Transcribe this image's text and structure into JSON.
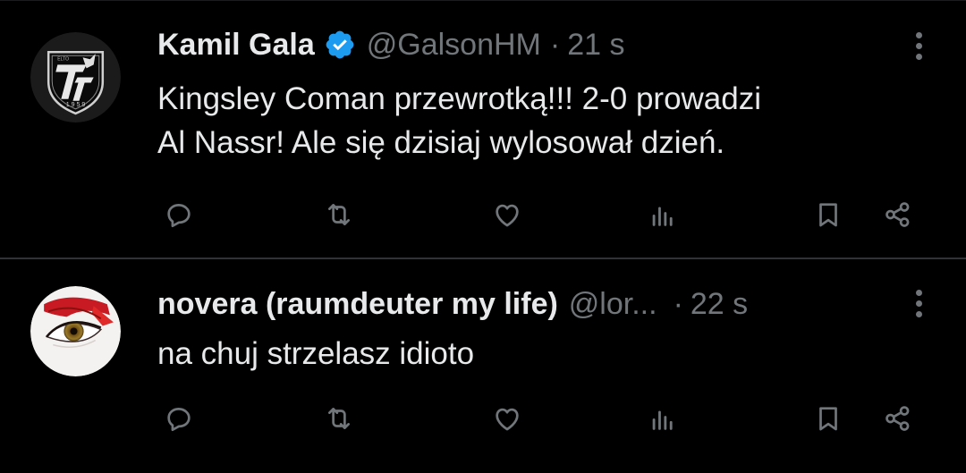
{
  "tweets": [
    {
      "name": "Kamil Gala",
      "verified": true,
      "handle": "@GalsonHM",
      "separator": "·",
      "time": "21 s",
      "text_lines": [
        "Kingsley Coman przewrotką!!! 2-0 prowadzi",
        "Al Nassr! Ale się dzisiaj wylosował dzień."
      ],
      "avatar_icon": "club-crest-logo"
    },
    {
      "name": "novera (raumdeuter my life)",
      "verified": false,
      "handle": "@lor...",
      "separator": "·",
      "time": "22 s",
      "text_lines": [
        "na chuj strzelasz idioto"
      ],
      "avatar_icon": "eye-closeup-photo"
    }
  ],
  "actions": [
    "reply-icon",
    "retweet-icon",
    "like-icon",
    "views-icon",
    "bookmark-icon",
    "share-icon"
  ],
  "colors": {
    "background": "#000000",
    "text": "#e7e9ea",
    "muted": "#71767b",
    "divider": "#2f3336",
    "verified": "#1d9bf0"
  }
}
